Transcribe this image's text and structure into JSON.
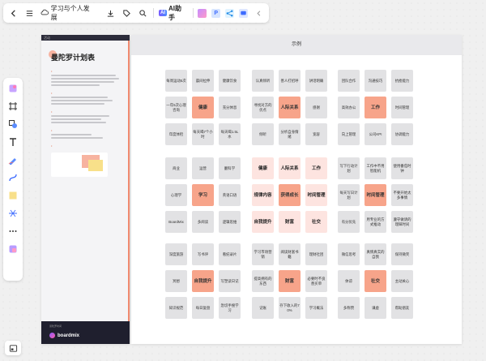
{
  "toolbar": {
    "doc_title": "学习与个人发展",
    "ai_label": "AI助手",
    "ai_badge": "AI"
  },
  "document": {
    "top_label": "活动",
    "heading": "曼陀罗计划表",
    "footer_text": "曼陀罗时间",
    "brand": "boardmix"
  },
  "board": {
    "header": "示例",
    "blocks": [
      [
        "每周运动5次",
        "晨间拉伸",
        "健康饮食",
        "一年5次心理咨询",
        "健康",
        "充分休息",
        "年度体检",
        "每天喝7个小时",
        "每天喝1.5L水"
      ],
      [
        "认真倾听",
        "善人打招呼",
        "讲话明确",
        "寻找对方的优点",
        "人际关系",
        "感谢",
        "倾听",
        "分析自身情绪",
        "宽容"
      ],
      [
        "团队合作",
        "沟通技巧",
        "抗挫能力",
        "高效办公",
        "工作",
        "时间管理",
        "向上管理",
        "公司KPI",
        "协调能力"
      ],
      [
        "商业",
        "运营",
        "翻科学",
        "心理学",
        "学习",
        "英语口语",
        "BoardMix",
        "多阅读",
        "逻辑思维"
      ],
      [
        "健康",
        "人际关系",
        "工作",
        "规律内容",
        "获得成长",
        "时间管理",
        "自我提升",
        "财富",
        "社交"
      ],
      [
        "写下行动计划",
        "工作中不用智能机",
        "使用番茄时钟",
        "每天写日计划",
        "时间管理",
        "不要开始太多事情",
        "有分优先",
        "用专业的方式推动",
        "遵守做请的理睬时间"
      ],
      [
        "深度旅游",
        "写书评",
        "看纪录片",
        "冥想",
        "自我提升",
        "写塑读日记",
        "知识规范",
        "每日复盘",
        "急切手搜学习"
      ],
      [
        "学习市场营销",
        "阅读财富书籍",
        "理财社团",
        "提高拥有的东西",
        "财富",
        "必要时不良善买单",
        "记账",
        "存下收入的70%",
        "学习概法"
      ],
      [
        "微信思考",
        "真情真实的自我",
        "保持微笑",
        "体谅",
        "社交",
        "主动关心",
        "多称赞",
        "谦虚",
        "帮助朋友"
      ]
    ],
    "pink_cells": [
      [
        1,
        4
      ],
      [
        4,
        1
      ],
      [
        4,
        4
      ],
      [
        4,
        5
      ],
      [
        5,
        4
      ]
    ]
  }
}
